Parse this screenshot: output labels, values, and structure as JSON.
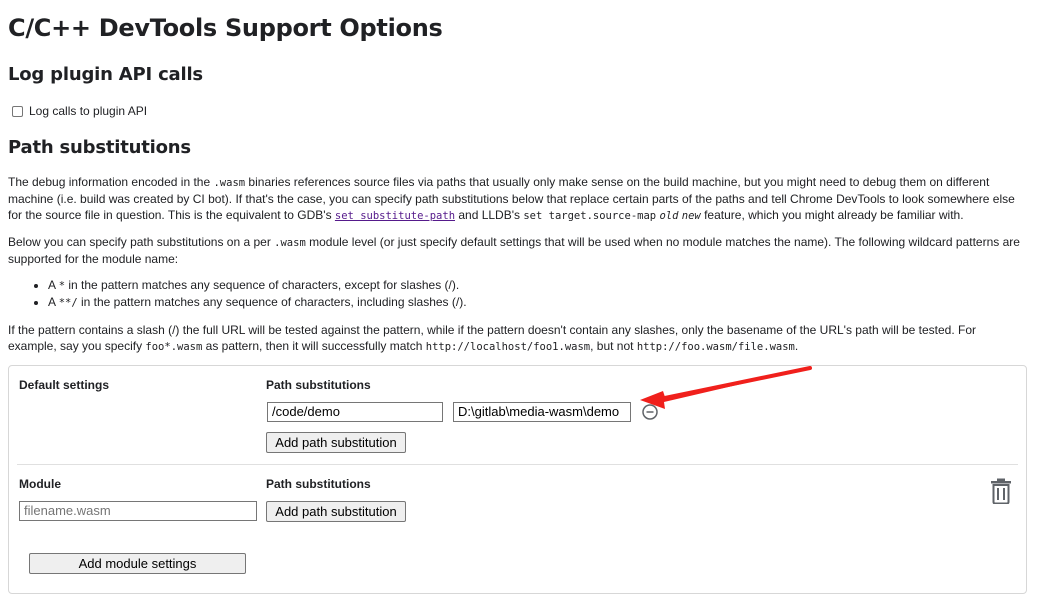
{
  "page": {
    "title": "C/C++ DevTools Support Options"
  },
  "log_section": {
    "heading": "Log plugin API calls",
    "checkbox_label": "Log calls to plugin API"
  },
  "path_section": {
    "heading": "Path substitutions",
    "para1": {
      "t1": "The debug information encoded in the ",
      "c1": ".wasm",
      "t2": " binaries references source files via paths that usually only make sense on the build machine, but you might need to debug them on different machine (i.e. build was created by CI bot). If that's the case, you can specify path substitutions below that replace certain parts of the paths and tell Chrome DevTools to look somewhere else for the source file in question. This is the equivalent to GDB's ",
      "link": "set substitute-path",
      "t3": " and LLDB's ",
      "c2": "set target.source-map",
      "i1": "old",
      "i2": "new",
      "t4": " feature, which you might already be familiar with."
    },
    "para2": {
      "t1": "Below you can specify path substitutions on a per ",
      "c1": ".wasm",
      "t2": " module level (or just specify default settings that will be used when no module matches the name). The following wildcard patterns are supported for the module name:"
    },
    "bullets": [
      {
        "pre": "A ",
        "code": "*",
        "post": " in the pattern matches any sequence of characters, except for slashes (/)."
      },
      {
        "pre": "A ",
        "code": "**/",
        "post": " in the pattern matches any sequence of characters, including slashes (/)."
      }
    ],
    "para3": {
      "t1": "If the pattern contains a slash (/) the full URL will be tested against the pattern, while if the pattern doesn't contain any slashes, only the basename of the URL's path will be tested. For example, say you specify ",
      "c1": "foo*.wasm",
      "t2": " as pattern, then it will successfully match ",
      "c2": "http://localhost/foo1.wasm",
      "t3": ", but not ",
      "c3": "http://foo.wasm/file.wasm",
      "t4": "."
    }
  },
  "default_settings": {
    "label": "Default settings",
    "path_label": "Path substitutions",
    "from_value": "/code/demo",
    "to_value": "D:\\gitlab\\media-wasm\\demo",
    "add_path_button": "Add path substitution"
  },
  "module_settings": {
    "label": "Module",
    "path_label": "Path substitutions",
    "module_placeholder": "filename.wasm",
    "add_path_button": "Add path substitution",
    "add_module_button": "Add module settings"
  },
  "colors": {
    "annotation_arrow": "#f0201c",
    "link": "#551a8b",
    "border": "#d7d7d7"
  },
  "icons": {
    "remove": "minus-circle-icon",
    "delete": "trash-icon",
    "arrow": "red-arrow-annotation"
  }
}
